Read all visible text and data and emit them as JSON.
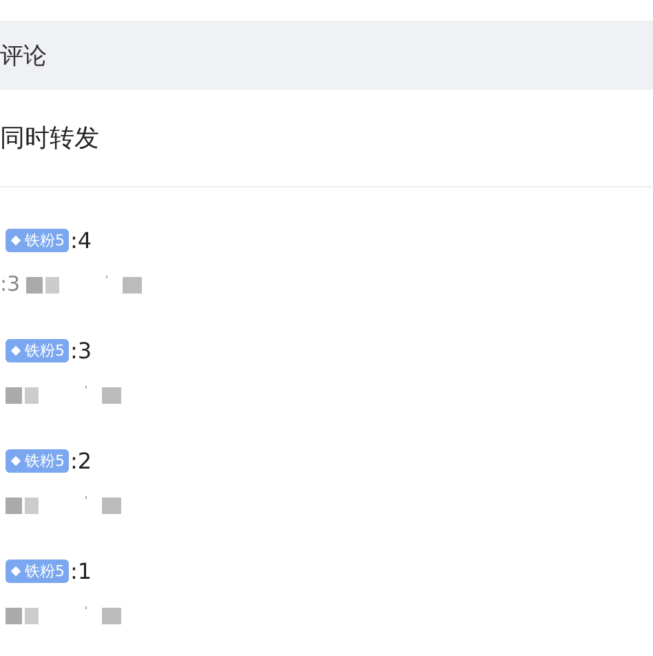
{
  "header": {
    "title": "评论"
  },
  "forward": {
    "label": "同时转发"
  },
  "comments": [
    {
      "badge": "铁粉5",
      "number": ":4",
      "meta": ":3"
    },
    {
      "badge": "铁粉5",
      "number": ":3"
    },
    {
      "badge": "铁粉5",
      "number": ":2"
    },
    {
      "badge": "铁粉5",
      "number": ":1"
    }
  ]
}
